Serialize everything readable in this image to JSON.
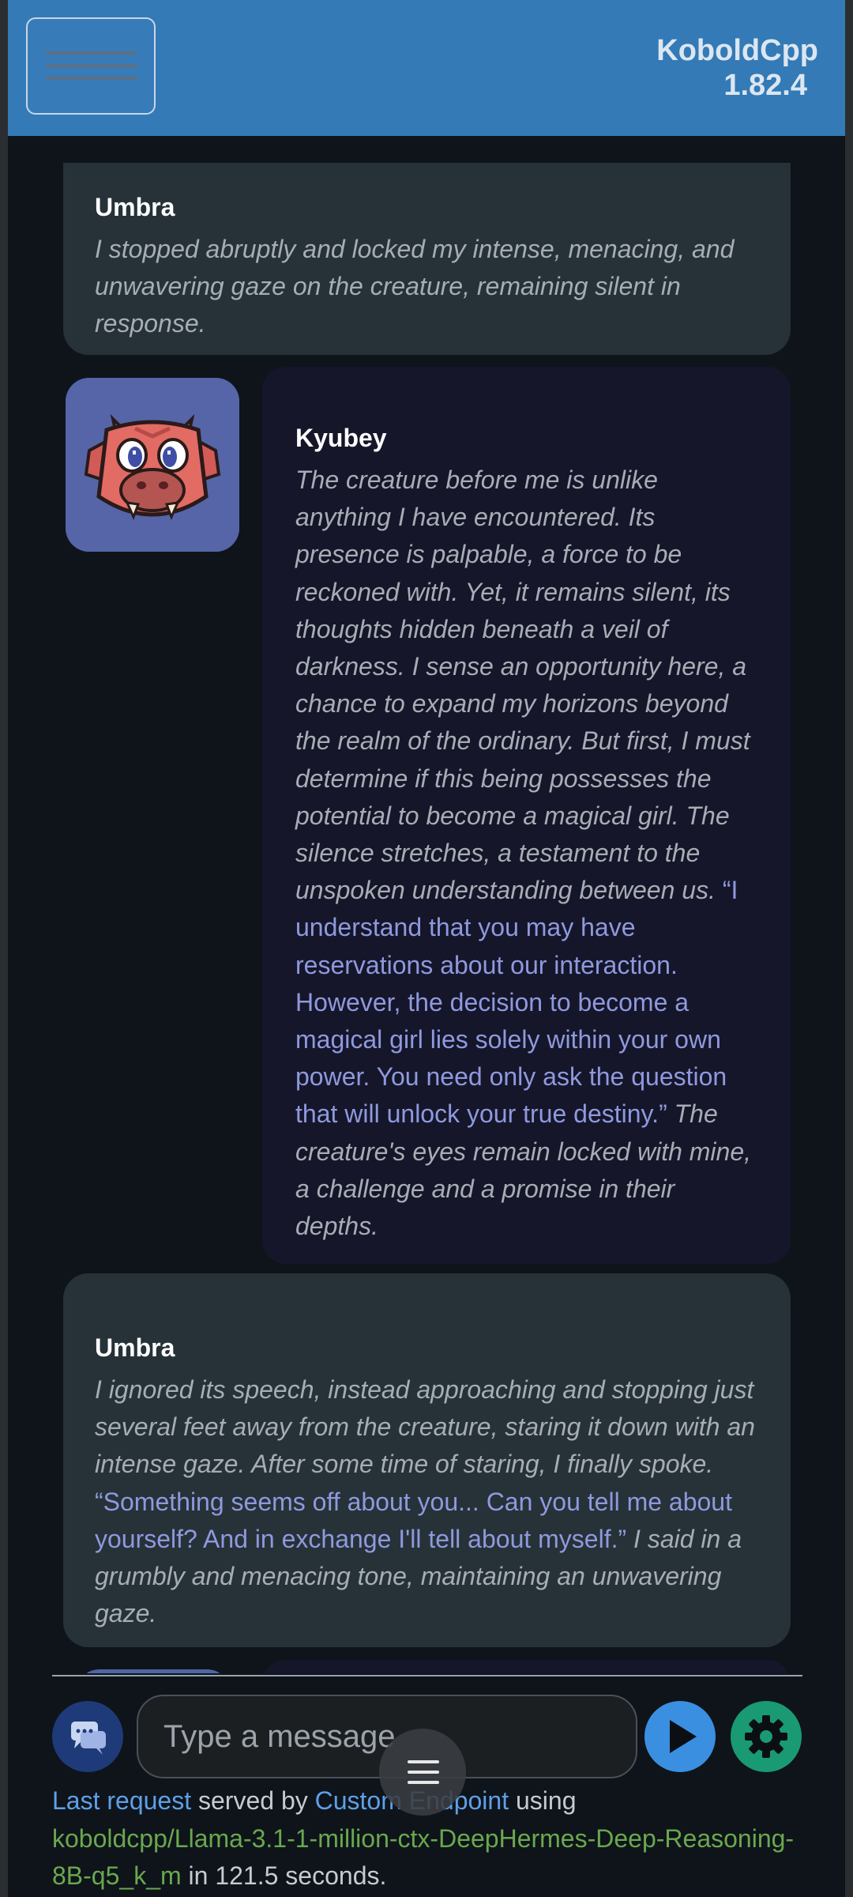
{
  "app": {
    "name": "KoboldCpp",
    "version": "1.82.4"
  },
  "messages": [
    {
      "sender": "Umbra",
      "role": "user",
      "parts": [
        {
          "kind": "action",
          "text": "I stopped abruptly and locked my intense, menacing, and unwavering gaze on the creature, remaining silent in response."
        }
      ]
    },
    {
      "sender": "Kyubey",
      "role": "bot",
      "parts": [
        {
          "kind": "action",
          "text": "The creature before me is unlike anything I have encountered. Its presence is palpable, a force to be reckoned with. Yet, it remains silent, its thoughts hidden beneath a veil of darkness. I sense an opportunity here, a chance to expand my horizons beyond the realm of the ordinary. But first, I must determine if this being possesses the potential to become a magical girl. The silence stretches, a testament to the unspoken understanding between us. "
        },
        {
          "kind": "speech",
          "text": "“I understand that you may have reservations about our interaction. However, the decision to become a magical girl lies solely within your own power. You need only ask the question that will unlock your true destiny.”"
        },
        {
          "kind": "action",
          "text": " The creature's eyes remain locked with mine, a challenge and a promise in their depths."
        }
      ]
    },
    {
      "sender": "Umbra",
      "role": "user",
      "parts": [
        {
          "kind": "action",
          "text": "I ignored its speech, instead approaching and stopping just several feet away from the creature, staring it down with an intense gaze. After some time of staring, I finally spoke. "
        },
        {
          "kind": "speech",
          "text": "“Something seems off about you... Can you tell me about yourself? And in exchange I'll tell about myself.”"
        },
        {
          "kind": "action",
          "text": " I said in a grumbly and menacing tone, maintaining an unwavering gaze."
        }
      ]
    }
  ],
  "input": {
    "placeholder": "Type a message"
  },
  "icons": {
    "menu": "hamburger-icon",
    "chat_mode": "chat-bubbles-icon",
    "send": "play-icon",
    "settings": "gear-icon",
    "fab": "hamburger-icon",
    "avatar": "pixel-creature-avatar"
  },
  "status": {
    "link1": "Last request",
    "text1": " served by ",
    "link2": "Custom Endpoint",
    "text2": " using",
    "model": "koboldcpp/Llama-3.1-1-million-ctx-DeepHermes-Deep-Reasoning-8B-q5_k_m",
    "text3": " in 121.5 seconds."
  },
  "colors": {
    "topbar": "#337ab7",
    "background": "#0e141a",
    "user_bubble": "#263238",
    "bot_bubble": "#15162a",
    "speech_text": "#8f99dd",
    "action_text": "#a7adb4",
    "send_button": "#3b8fe0",
    "settings_button": "#1a9a72",
    "chat_mode_button": "#1f3a78"
  }
}
